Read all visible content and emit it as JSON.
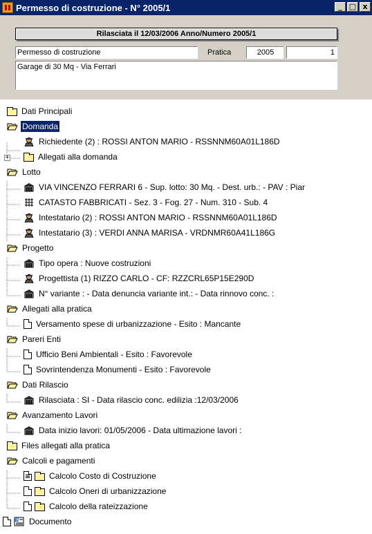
{
  "window": {
    "title": "Permesso di costruzione - N° 2005/1",
    "buttons": {
      "minimize": "_",
      "maximize": "□",
      "close": "x"
    }
  },
  "header": {
    "banner": "Rilasciata il 12/03/2006 Anno/Numero 2005/1",
    "type_value": "Permesso di costruzione",
    "pratica_label": "Pratica",
    "year_value": "2005",
    "number_value": "1",
    "description_value": "Garage di 30 Mq - Via Ferrari"
  },
  "tree": {
    "dati_principali": "Dati Principali",
    "domanda": "Domanda",
    "richiedente": "Richiedente (2) : ROSSI ANTON MARIO - RSSNNM60A01L186D",
    "allegati_domanda": "Allegati alla domanda",
    "lotto": "Lotto",
    "indirizzo": "VIA VINCENZO FERRARI 6 - Sup. lotto: 30 Mq. -  Dest. urb.: - PAV : Piar",
    "catasto": "CATASTO FABBRICATI - Sez. 3 - Fog. 27 - Num. 310 - Sub. 4",
    "intestatario2": "Intestatario (2) : ROSSI ANTON MARIO - RSSNNM60A01L186D",
    "intestatario3": "Intestatario (3) : VERDI ANNA MARISA  - VRDNMR60A41L186G",
    "progetto": "Progetto",
    "tipo_opera": "Tipo opera : Nuove costruzioni",
    "progettista": "Progettista (1) RIZZO CARLO - CF: RZZCRL65P15E290D",
    "variante": "N° variante : - Data denuncia variante int.: - Data rinnovo conc. :",
    "allegati_pratica": "Allegati alla pratica",
    "versamento": "Versamento spese di urbanizzazione - Esito : Mancante",
    "pareri_enti": "Pareri Enti",
    "ufficio_beni": "Ufficio Beni Ambientali - Esito : Favorevole",
    "sovrintendenza": "Sovrintendenza Monumenti - Esito : Favorevole",
    "dati_rilascio": "Dati Rilascio",
    "rilasciata": "Rilasciata : SI - Data rilascio conc. edilizia :12/03/2006",
    "avanzamento": "Avanzamento Lavori",
    "data_inizio": "Data inizio lavori: 01/05/2006 - Data ultimazione lavori :",
    "files_allegati": "Files allegati alla pratica",
    "calcoli": "Calcoli e pagamenti",
    "calcolo_costo": "Calcolo Costo di Costruzione",
    "calcolo_oneri": "Calcolo Oneri di urbanizzazione",
    "calcolo_rate": "Calcolo della rateizzazione",
    "documento": "Documento"
  }
}
